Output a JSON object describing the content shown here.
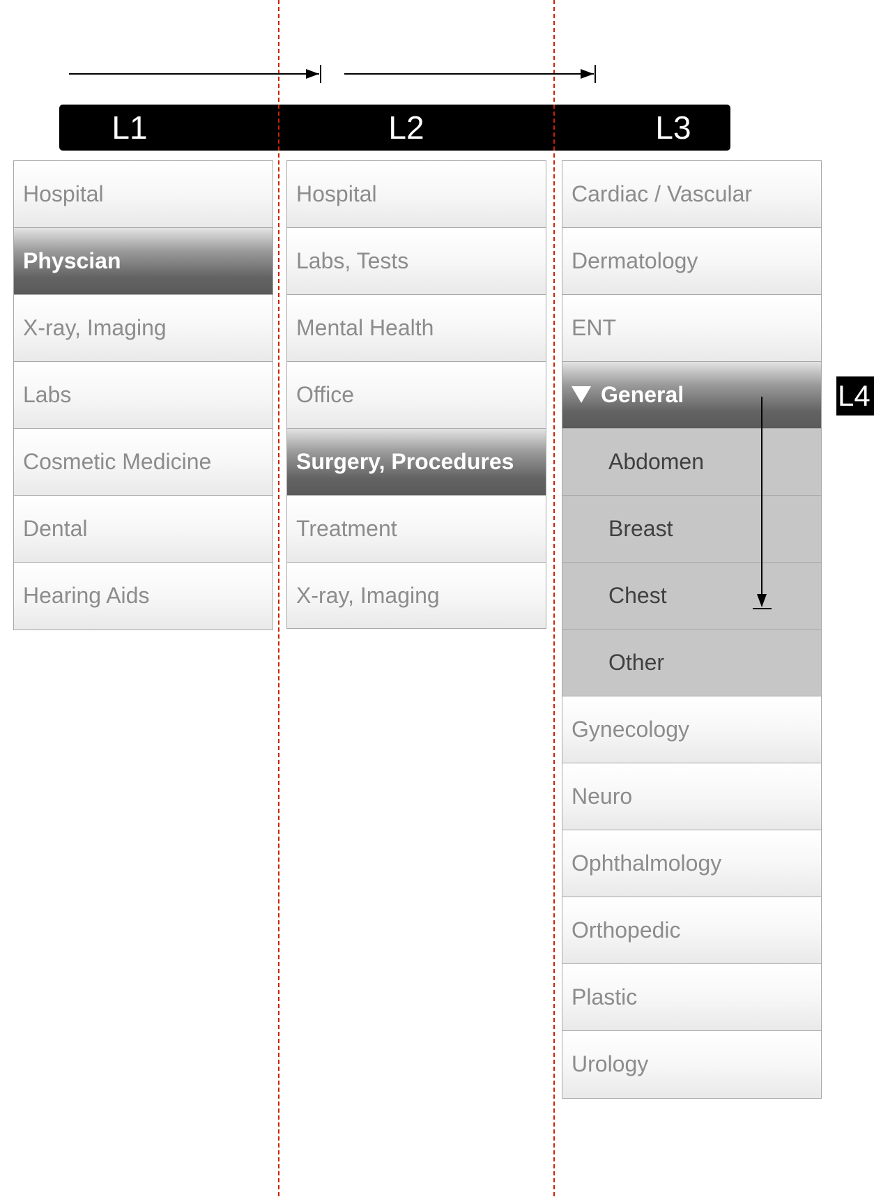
{
  "levels": {
    "l1": "L1",
    "l2": "L2",
    "l3": "L3",
    "l4": "L4"
  },
  "columns": {
    "l1": {
      "items": [
        "Hospital",
        "Physcian",
        "X-ray, Imaging",
        "Labs",
        "Cosmetic Medicine",
        "Dental",
        "Hearing Aids"
      ],
      "selected": "Physcian"
    },
    "l2": {
      "items": [
        "Hospital",
        "Labs, Tests",
        "Mental Health",
        "Office",
        "Surgery, Procedures",
        "Treatment",
        "X-ray, Imaging"
      ],
      "selected": "Surgery, Procedures"
    },
    "l3": {
      "items": [
        "Cardiac / Vascular",
        "Dermatology",
        "ENT",
        "General",
        "Gynecology",
        "Neuro",
        "Ophthalmology",
        "Orthopedic",
        "Plastic",
        "Urology"
      ],
      "expanded": "General",
      "subitems": [
        "Abdomen",
        "Breast",
        "Chest",
        "Other"
      ]
    }
  },
  "colors": {
    "divider_line": "#cc2200",
    "level_bar": "#000000",
    "selected_text": "#ffffff",
    "item_text": "#8c8c8c",
    "subitem_background": "#c6c6c6"
  }
}
